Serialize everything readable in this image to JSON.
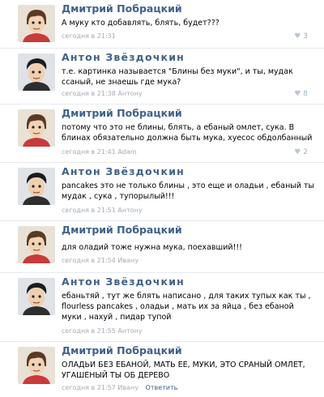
{
  "comments": [
    {
      "author": "Дмитрий Побрацкий",
      "text": "А муку кто добавлять, блять, будет???",
      "time": "сегодня в 21:31",
      "mention": "",
      "reply": "",
      "likes": "3"
    },
    {
      "author": "Антон Звёздочкин",
      "text": "т.е. картинка называется \"Блины без муки\", и ты, мудак ссаный, не знаешь где мука?",
      "time": "сегодня в 21:38",
      "mention": "Антону",
      "reply": "",
      "likes": "8"
    },
    {
      "author": "Дмитрий Побрацкий",
      "text": "потому что это не блины, блять, а ебаный омлет, сука. В блинах обязательно должна быть мука, хуесос обдолбанный",
      "time": "сегодня в 21:41",
      "mention": "Adam",
      "reply": "",
      "likes": "2"
    },
    {
      "author": "Антон Звёздочкин",
      "text": "pancakes это не только блины , это еще и оладьи , ебаный ты мудак , сука , тупорылый!!!",
      "time": "сегодня в 21:51",
      "mention": "Антону",
      "reply": "",
      "likes": ""
    },
    {
      "author": "Дмитрий Побрацкий",
      "text": "для оладий тоже нужна мука, поехавший!!!",
      "time": "сегодня в 21:54",
      "mention": "Ивану",
      "reply": "",
      "likes": ""
    },
    {
      "author": "Антон Звёздочкин",
      "text": "ебаньтяй , тут же блять написано , для таких тупых как ты , flourless pancakes , оладьи , мать их за яйца , без ебаной муки , нахуй , пидар тупой",
      "time": "сегодня в 21:55",
      "mention": "Антону",
      "reply": "",
      "likes": ""
    },
    {
      "author": "Дмитрий Побрацкий",
      "text": "ОЛАДЬИ БЕЗ ЕБАНОЙ, МАТЬ ЕЕ, МУКИ, ЭТО СРАНЫЙ ОМЛЕТ, УГАШЕНЫЙ ТЫ ОБ ДЕРЕВО",
      "time": "сегодня в 21:57",
      "mention": "Ивану",
      "reply": "Ответить",
      "likes": ""
    }
  ],
  "colors": {
    "author_link": "#3f6189",
    "meta_gray": "#a5acb6",
    "like_blue": "#9fb1c6",
    "divider": "#e6e9ee"
  },
  "icons": {
    "like": "heart-icon",
    "avatar_dmitry": "cartoon-avatar-red-shirt",
    "avatar_anton": "cartoon-avatar-black-hair"
  }
}
